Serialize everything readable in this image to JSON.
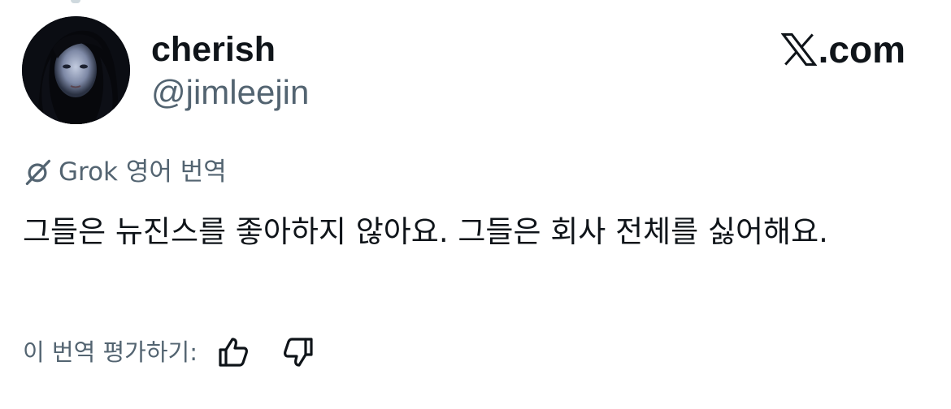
{
  "author": {
    "display_name": "cherish",
    "handle": "@jimleejin"
  },
  "brand": {
    "text": ".com",
    "icon": "x-logo-icon"
  },
  "translation": {
    "icon": "grok-icon",
    "label": "Grok 영어 번역"
  },
  "tweet": {
    "text": "그들은 뉴진스를 좋아하지 않아요. 그들은 회사 전체를 싫어해요."
  },
  "rating": {
    "prompt": "이 번역 평가하기:",
    "thumbs_up_icon": "thumbs-up-icon",
    "thumbs_down_icon": "thumbs-down-icon"
  },
  "colors": {
    "primary_text": "#0f1419",
    "secondary_text": "#536471",
    "background": "#ffffff"
  }
}
